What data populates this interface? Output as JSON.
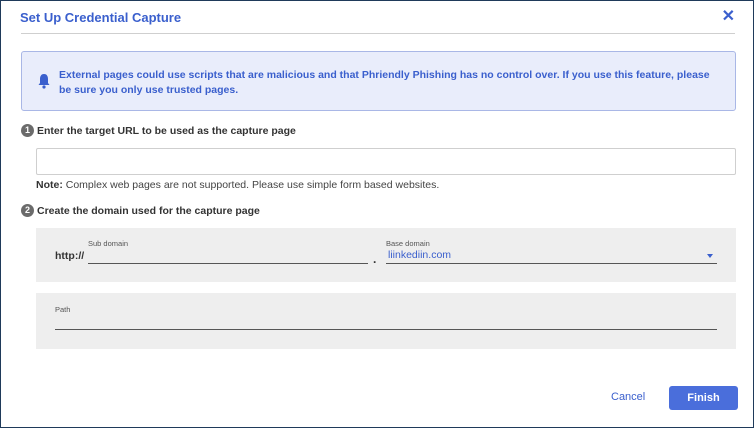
{
  "dialog": {
    "title": "Set Up Credential Capture",
    "close_icon": "close-icon"
  },
  "alert": {
    "icon": "bell-icon",
    "message": "External pages could use scripts that are malicious and that Phriendly Phishing has no control over. If you use this feature, please be sure you only use trusted pages."
  },
  "step1": {
    "number": "1",
    "label": "Enter the target URL to be used as the capture page",
    "url_value": "",
    "note_label": "Note:",
    "note_text": " Complex web pages are not supported. Please use simple form based websites."
  },
  "step2": {
    "number": "2",
    "label": "Create the domain used for the capture page",
    "protocol": "http://",
    "sub_domain_label": "Sub domain",
    "sub_domain_value": "",
    "separator": ".",
    "base_domain_label": "Base domain",
    "base_domain_value": "liinkediin.com",
    "path_label": "Path",
    "path_value": ""
  },
  "actions": {
    "cancel_label": "Cancel",
    "finish_label": "Finish"
  },
  "colors": {
    "accent": "#3a5fcd",
    "primary_button": "#4a6edb",
    "alert_bg": "#e9edfb",
    "panel_bg": "#eeeeee"
  }
}
